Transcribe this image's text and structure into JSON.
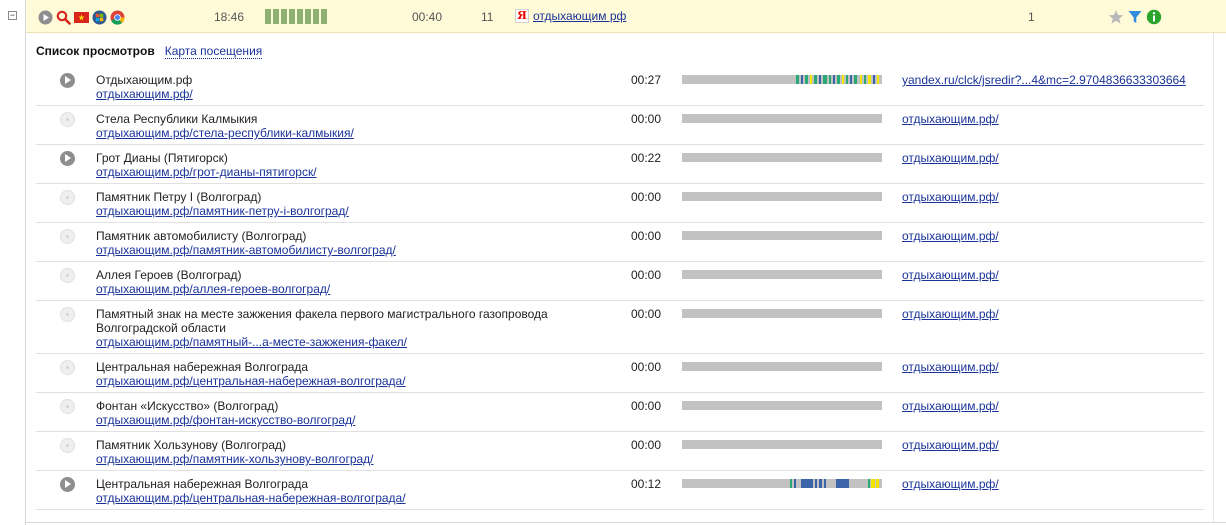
{
  "visit": {
    "time": "18:46",
    "duration": "00:40",
    "depth": "11",
    "source_label": "отдыхающим рф",
    "count": "1",
    "bar_segments": 8,
    "icons": [
      "play-icon",
      "search-icon",
      "vietnam-flag-icon",
      "windows-icon",
      "chrome-icon"
    ],
    "actions": [
      "star-icon",
      "filter-icon",
      "info-icon"
    ]
  },
  "tabs": {
    "active": "Список просмотров",
    "link": "Карта посещения"
  },
  "pageviews": [
    {
      "title": "Отдыхающим.рф",
      "url": "отдыхающим.рф/",
      "time": "00:27",
      "ref": "yandex.ru/clck/jsredir?...4&mc=2.9704836633303664",
      "played": true,
      "activity": "high"
    },
    {
      "title": "Стела Республики Калмыкия",
      "url": "отдыхающим.рф/стела-республики-калмыкия/",
      "time": "00:00",
      "ref": "отдыхающим.рф/",
      "played": false,
      "activity": "none"
    },
    {
      "title": "Грот Дианы (Пятигорск)",
      "url": "отдыхающим.рф/грот-дианы-пятигорск/",
      "time": "00:22",
      "ref": "отдыхающим.рф/",
      "played": true,
      "activity": "none"
    },
    {
      "title": "Памятник Петру I (Волгоград)",
      "url": "отдыхающим.рф/памятник-петру-i-волгоград/",
      "time": "00:00",
      "ref": "отдыхающим.рф/",
      "played": false,
      "activity": "none"
    },
    {
      "title": "Памятник автомобилисту (Волгоград)",
      "url": "отдыхающим.рф/памятник-автомобилисту-волгоград/",
      "time": "00:00",
      "ref": "отдыхающим.рф/",
      "played": false,
      "activity": "none"
    },
    {
      "title": "Аллея Героев (Волгоград)",
      "url": "отдыхающим.рф/аллея-героев-волгоград/",
      "time": "00:00",
      "ref": "отдыхающим.рф/",
      "played": false,
      "activity": "none"
    },
    {
      "title": "Памятный знак на месте зажжения факела первого магистрального газопровода Волгоградской области",
      "url": "отдыхающим.рф/памятный-...а-месте-зажжения-факел/",
      "time": "00:00",
      "ref": "отдыхающим.рф/",
      "played": false,
      "activity": "none"
    },
    {
      "title": "Центральная набережная Волгограда",
      "url": "отдыхающим.рф/центральная-набережная-волгограда/",
      "time": "00:00",
      "ref": "отдыхающим.рф/",
      "played": false,
      "activity": "none"
    },
    {
      "title": "Фонтан «Искусство» (Волгоград)",
      "url": "отдыхающим.рф/фонтан-искусство-волгоград/",
      "time": "00:00",
      "ref": "отдыхающим.рф/",
      "played": false,
      "activity": "none"
    },
    {
      "title": "Памятник Хользунову (Волгоград)",
      "url": "отдыхающим.рф/памятник-хользунову-волгоград/",
      "time": "00:00",
      "ref": "отдыхающим.рф/",
      "played": false,
      "activity": "none"
    },
    {
      "title": "Центральная набережная Волгограда",
      "url": "отдыхающим.рф/центральная-набережная-волгограда/",
      "time": "00:12",
      "ref": "отдыхающим.рф/",
      "played": true,
      "activity": "medium"
    }
  ],
  "colors": {
    "header_bg": "#fffbd9",
    "link": "#1a3399",
    "bar_bg": "#c2c2c2",
    "activity_green": "#2aa876",
    "activity_yellow": "#f2e600",
    "activity_blue": "#3c64a8"
  }
}
